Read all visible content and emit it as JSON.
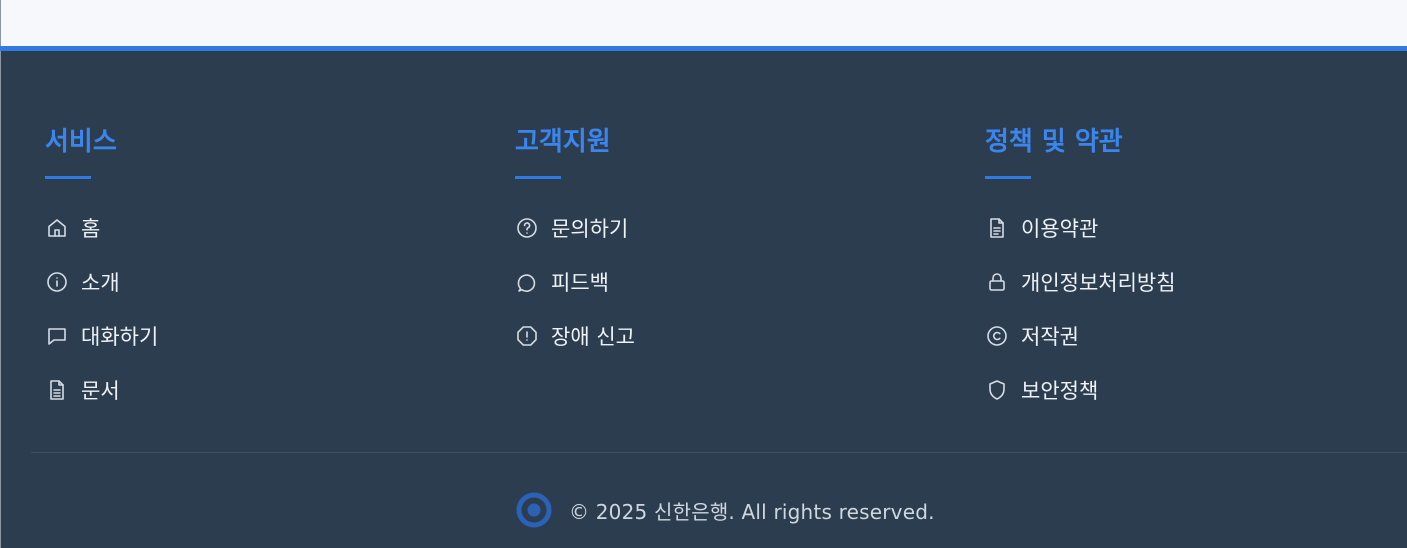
{
  "columns": [
    {
      "title": "서비스",
      "items": [
        {
          "label": "홈",
          "icon": "home-icon"
        },
        {
          "label": "소개",
          "icon": "info-icon"
        },
        {
          "label": "대화하기",
          "icon": "chat-icon"
        },
        {
          "label": "문서",
          "icon": "document-icon"
        }
      ]
    },
    {
      "title": "고객지원",
      "items": [
        {
          "label": "문의하기",
          "icon": "question-circle-icon"
        },
        {
          "label": "피드백",
          "icon": "message-circle-icon"
        },
        {
          "label": "장애 신고",
          "icon": "alert-octagon-icon"
        }
      ]
    },
    {
      "title": "정책 및 약관",
      "items": [
        {
          "label": "이용약관",
          "icon": "file-text-icon"
        },
        {
          "label": "개인정보처리방침",
          "icon": "lock-icon"
        },
        {
          "label": "저작권",
          "icon": "copyright-icon"
        },
        {
          "label": "보안정책",
          "icon": "shield-icon"
        }
      ]
    }
  ],
  "footer": {
    "copyright": "© 2025 신한은행. All rights reserved.",
    "logo_icon": "brand-ring-logo"
  },
  "colors": {
    "background": "#2d3d50",
    "accent": "#2f7be3",
    "heading": "#3b86ee",
    "link_text": "#eef2f6",
    "top_area": "#f6f8fb"
  }
}
